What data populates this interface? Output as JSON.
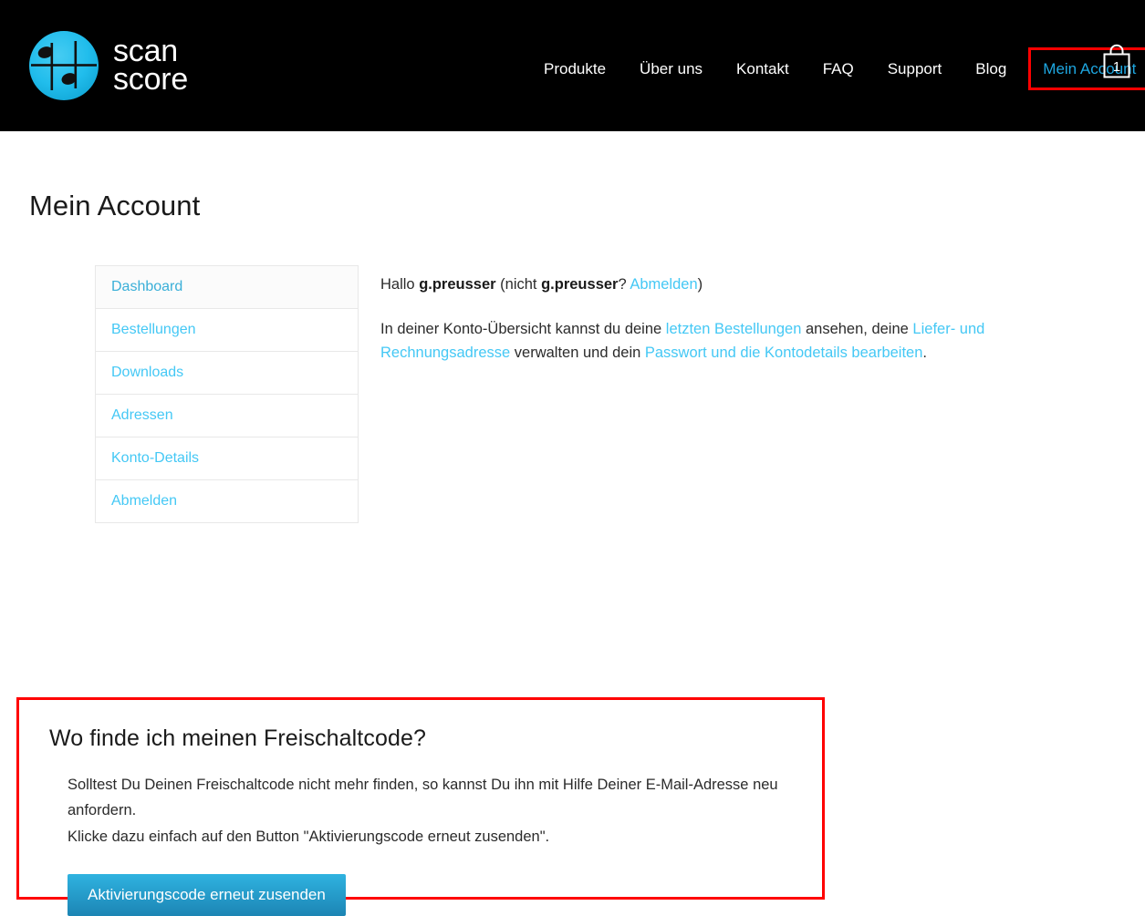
{
  "header": {
    "brand": {
      "logo_icon": "scanscore-music-note-circle-logo",
      "line1": "scan",
      "line2": "score"
    },
    "nav": [
      {
        "label": "Produkte"
      },
      {
        "label": "Über uns"
      },
      {
        "label": "Kontakt"
      },
      {
        "label": "FAQ"
      },
      {
        "label": "Support"
      },
      {
        "label": "Blog"
      }
    ],
    "account_link": {
      "label": "Mein Account",
      "highlighted": true
    },
    "cart": {
      "icon": "shopping-bag-icon",
      "count": "1"
    },
    "colors": {
      "background": "#000000",
      "nav_text": "#ffffff",
      "account_accent": "#1ea7e1",
      "highlight_box": "#ff0000"
    }
  },
  "page": {
    "title": "Mein Account"
  },
  "account_nav": {
    "items": [
      {
        "label": "Dashboard",
        "active": true
      },
      {
        "label": "Bestellungen",
        "active": false
      },
      {
        "label": "Downloads",
        "active": false
      },
      {
        "label": "Adressen",
        "active": false
      },
      {
        "label": "Konto-Details",
        "active": false
      },
      {
        "label": "Abmelden",
        "active": false
      }
    ],
    "link_color": "#44c8f5",
    "active_link_color": "#3aafd8"
  },
  "account_content": {
    "greeting": {
      "prefix": "Hallo ",
      "username": "g.preusser",
      "middle": " (nicht ",
      "username2": "g.preusser",
      "question": "? ",
      "logout_link": "Abmelden",
      "suffix": ")"
    },
    "overview": {
      "part1": "In deiner Konto-Übersicht kannst du deine ",
      "link1": "letzten Bestellungen",
      "part2": " ansehen, deine ",
      "link2": "Liefer- und Rechnungsadresse",
      "part3": " verwalten und dein ",
      "link3": "Passwort und die Kontodetails bearbeiten",
      "part4": "."
    }
  },
  "callout": {
    "heading": "Wo finde ich meinen Freischaltcode?",
    "paragraph_line1": "Solltest Du Deinen Freischaltcode nicht mehr finden, so kannst Du ihn mit Hilfe Deiner E-Mail-Adresse neu anfordern.",
    "paragraph_line2": "Klicke dazu einfach auf den Button \"Aktivierungscode erneut zusenden\".",
    "button_label": "Aktivierungscode erneut zusenden",
    "highlight_border_color": "#ff0000",
    "button_color_top": "#2fb3e0",
    "button_color_bottom": "#1c85b4"
  }
}
